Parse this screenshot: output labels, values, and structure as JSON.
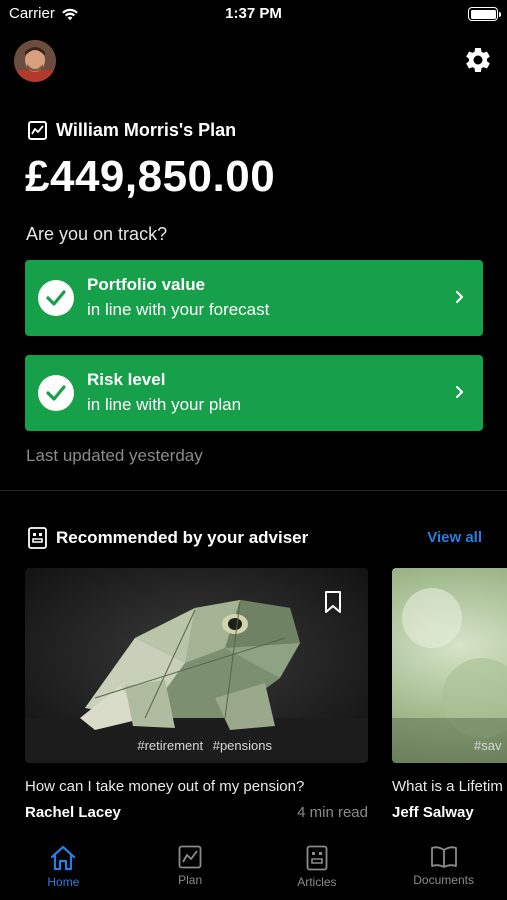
{
  "status_bar": {
    "carrier": "Carrier",
    "time": "1:37 PM"
  },
  "header": {
    "avatar_icon": "avatar-photo",
    "settings_icon": "gear-icon"
  },
  "plan": {
    "title": "William Morris's Plan",
    "amount": "£449,850.00",
    "track_question": "Are you on track?",
    "cards": [
      {
        "title": "Portfolio value",
        "subtitle": "in line with your forecast"
      },
      {
        "title": "Risk level",
        "subtitle": "in line with your plan"
      }
    ],
    "last_updated": "Last updated yesterday",
    "status_color": "#16a04a"
  },
  "recommended": {
    "title": "Recommended by your adviser",
    "view_all": "View all",
    "articles": [
      {
        "tags": "#retirement #pensions",
        "title": "How can I take money out of my pension?",
        "author": "Rachel Lacey",
        "read_time": "4 min read"
      },
      {
        "tags": "#sav",
        "title": "What is a Lifetim",
        "author": "Jeff Salway",
        "read_time": ""
      }
    ]
  },
  "tabbar": {
    "accent": "#2b7de0",
    "tabs": [
      {
        "label": "Home",
        "icon": "home-icon",
        "active": true
      },
      {
        "label": "Plan",
        "icon": "chart-icon",
        "active": false
      },
      {
        "label": "Articles",
        "icon": "articles-icon",
        "active": false
      },
      {
        "label": "Documents",
        "icon": "book-icon",
        "active": false
      }
    ]
  }
}
